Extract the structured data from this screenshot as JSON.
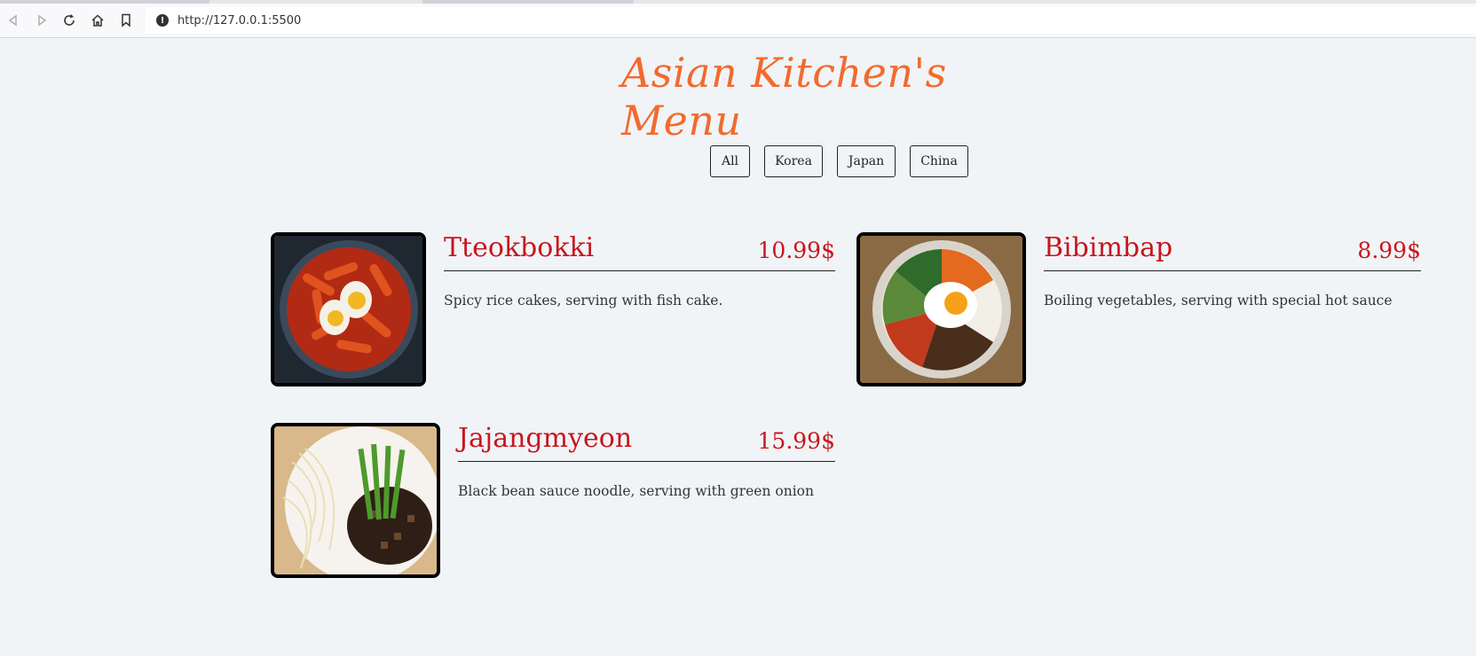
{
  "browser": {
    "url": "http://127.0.0.1:5500"
  },
  "page": {
    "title": "Asian Kitchen's Menu",
    "filters": [
      "All",
      "Korea",
      "Japan",
      "China"
    ]
  },
  "menu": [
    {
      "name": "Tteokbokki",
      "price": "10.99$",
      "desc": "Spicy rice cakes, serving with fish cake."
    },
    {
      "name": "Bibimbap",
      "price": "8.99$",
      "desc": "Boiling vegetables, serving with special hot sauce"
    },
    {
      "name": "Jajangmyeon",
      "price": "15.99$",
      "desc": "Black bean sauce noodle, serving with green onion"
    }
  ]
}
